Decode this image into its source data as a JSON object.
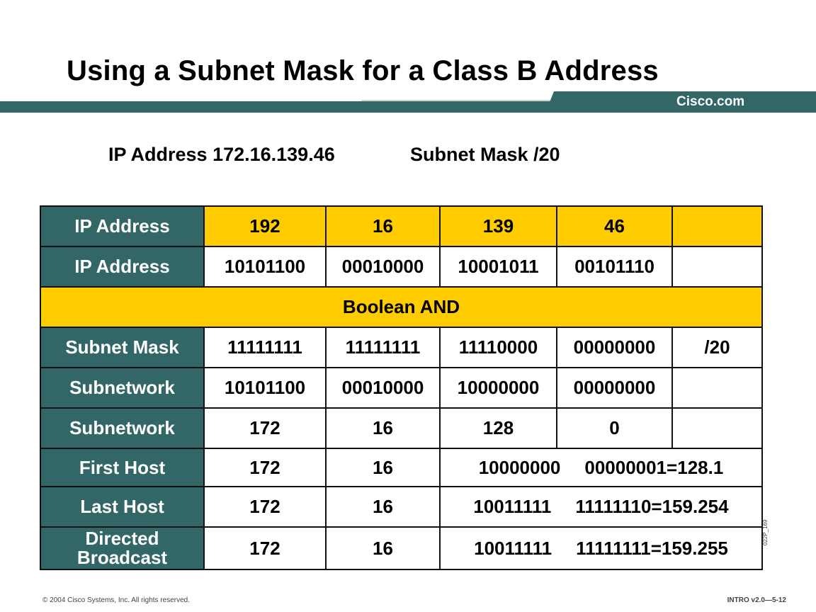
{
  "slide": {
    "title": "Using a Subnet Mask for a Class B Address",
    "brand": "Cisco.com",
    "subtitle_ip": "IP Address 172.16.139.46",
    "subtitle_mask": "Subnet Mask /20",
    "side_code": "022P_169",
    "footer_left": "© 2004 Cisco Systems, Inc. All rights reserved.",
    "footer_right": "INTRO v2.0—5-12"
  },
  "table": {
    "rows": [
      {
        "label": "IP Address",
        "cells": [
          "192",
          "16",
          "139",
          "46",
          ""
        ]
      },
      {
        "label": "IP Address",
        "cells": [
          "10101100",
          "00010000",
          "10001011",
          "00101110",
          ""
        ]
      },
      {
        "banner": "Boolean AND"
      },
      {
        "label": "Subnet Mask",
        "cells": [
          "11111111",
          "11111111",
          "11110000",
          "00000000",
          "/20"
        ]
      },
      {
        "label": "Subnetwork",
        "cells": [
          "10101100",
          "00010000",
          "10000000",
          "00000000",
          ""
        ]
      },
      {
        "label": "Subnetwork",
        "cells": [
          "172",
          "16",
          "128",
          "0",
          ""
        ]
      },
      {
        "label": "First Host",
        "cells": [
          "172",
          "16"
        ],
        "host_bits": "10000000",
        "host_result": "00000001=128.1"
      },
      {
        "label": "Last Host",
        "cells": [
          "172",
          "16"
        ],
        "host_bits": "10011111",
        "host_result": "11111110=159.254"
      },
      {
        "label": "Directed Broadcast",
        "cells": [
          "172",
          "16"
        ],
        "host_bits": "10011111",
        "host_result": "11111111=159.255"
      }
    ]
  },
  "colors": {
    "teal": "#336666",
    "yellow": "#ffcc00"
  }
}
